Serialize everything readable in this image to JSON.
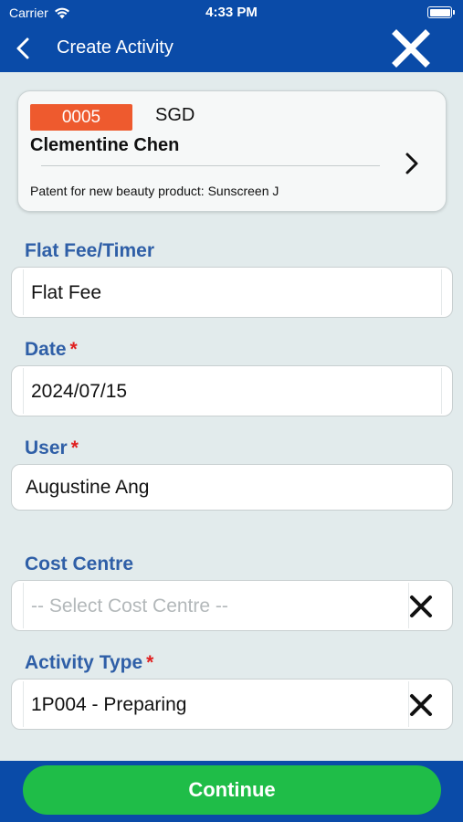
{
  "status_bar": {
    "carrier": "Carrier",
    "time": "4:33 PM"
  },
  "header": {
    "title": "Create Activity",
    "back_icon": "chevron-left-icon",
    "close_icon": "close-icon"
  },
  "matter_card": {
    "matter_number": "0005",
    "currency": "SGD",
    "client_name": "Clementine Chen",
    "matter_description": "Patent for new beauty product: Sunscreen J",
    "badge_color": "#ee5a2e"
  },
  "form": {
    "fee_type": {
      "label": "Flat Fee/Timer",
      "value": "Flat Fee"
    },
    "date": {
      "label": "Date",
      "required_mark": "*",
      "value": "2024/07/15"
    },
    "user": {
      "label": "User",
      "required_mark": "*",
      "value": "Augustine Ang"
    },
    "cost_centre": {
      "label": "Cost Centre",
      "placeholder": "-- Select Cost Centre --"
    },
    "activity_type": {
      "label": "Activity Type",
      "required_mark": "*",
      "value": "1P004 - Preparing"
    }
  },
  "footer": {
    "continue_label": "Continue",
    "button_color": "#1fbd48"
  },
  "colors": {
    "primary": "#0a4ba8",
    "background": "#e2ebec",
    "label": "#2f5fa7",
    "required": "#e02020"
  }
}
